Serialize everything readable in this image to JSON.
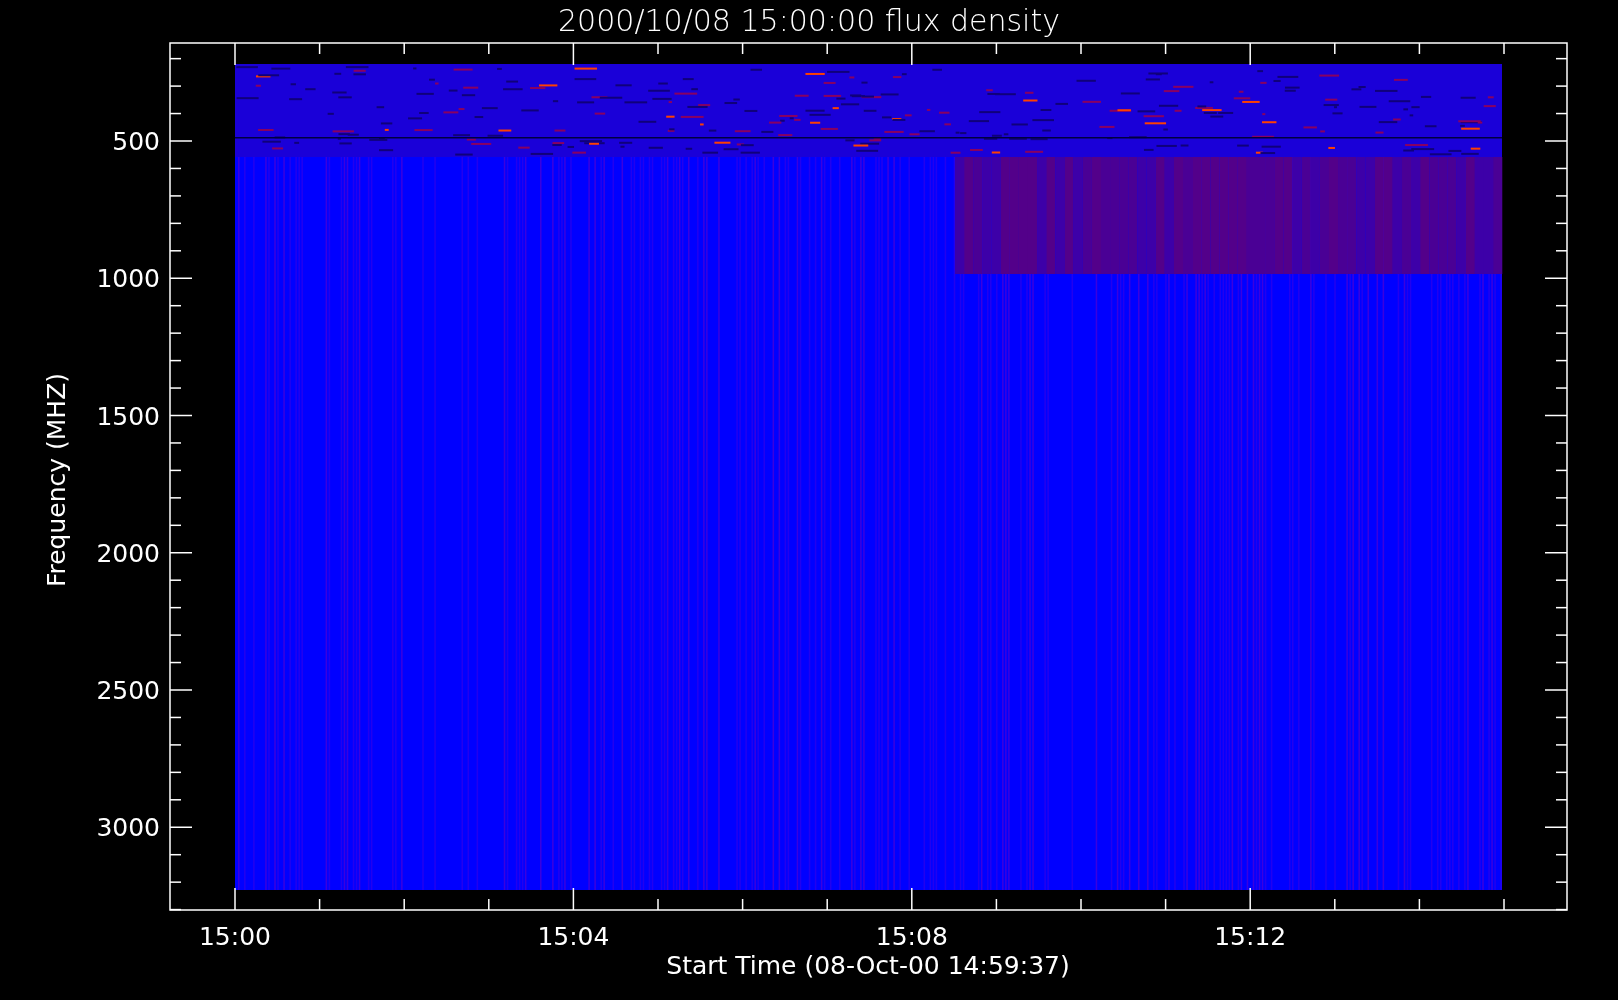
{
  "title": "2000/10/08 15:00:00 flux density",
  "y_axis": {
    "label": "Frequency (MHZ)",
    "ticks": [
      "500",
      "1000",
      "1500",
      "2000",
      "2500",
      "3000"
    ]
  },
  "x_axis": {
    "label": "Start Time (08-Oct-00 14:59:37)",
    "ticks": [
      "15:00",
      "15:04",
      "15:08",
      "15:12"
    ]
  }
}
